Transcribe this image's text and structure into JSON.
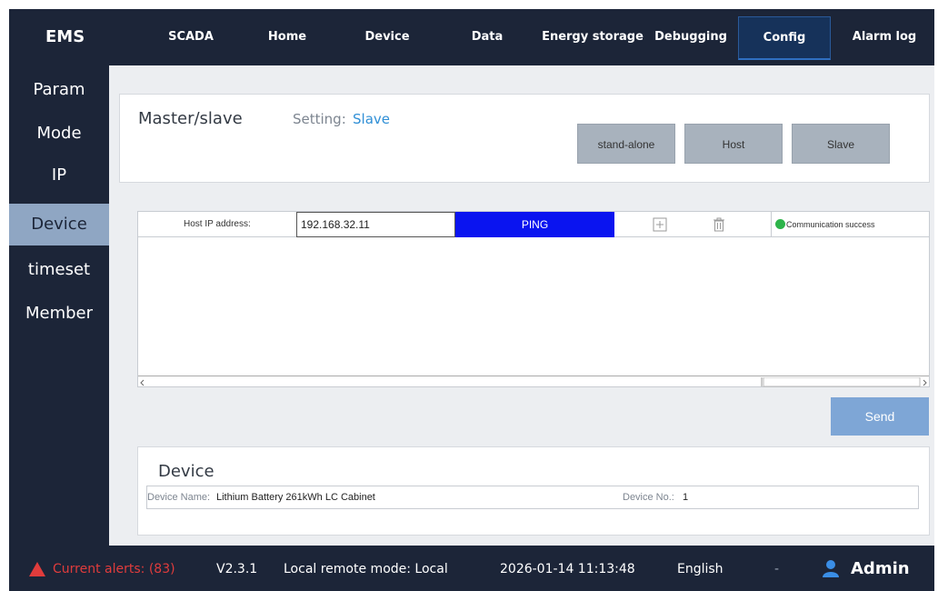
{
  "app": {
    "logo": "EMS",
    "nav": [
      "SCADA",
      "Home",
      "Device",
      "Data",
      "Energy storage",
      "Debugging",
      "Config",
      "Alarm log"
    ],
    "active_nav": "Config"
  },
  "sidebar": {
    "items": [
      "Param",
      "Mode",
      "IP",
      "Device",
      "timeset",
      "Member"
    ],
    "active": "Device"
  },
  "master_slave": {
    "title": "Master/slave",
    "setting_label": "Setting:",
    "setting_value": "Slave",
    "buttons": [
      "stand-alone",
      "Host",
      "Slave"
    ]
  },
  "host_table": {
    "host_ip_label": "Host IP address:",
    "host_ip_value": "192.168.32.11",
    "ping_label": "PING",
    "status_text": "Communication success",
    "add_icon": "plus-icon",
    "delete_icon": "trash-icon"
  },
  "send_label": "Send",
  "device": {
    "title": "Device",
    "name_label": "Device Name:",
    "name_value": "Lithium Battery 261kWh LC Cabinet",
    "no_label": "Device No.:",
    "no_value": "1"
  },
  "footer": {
    "alerts": "Current alerts: (83)",
    "version": "V2.3.1",
    "mode": "Local remote mode: Local",
    "datetime": "2026-01-14 11:13:48",
    "language": "English",
    "dropdown_caret": "-",
    "user": "Admin"
  },
  "colors": {
    "background": "#1c2538",
    "accent_blue": "#0a14f0",
    "send_button": "#7ea6d6",
    "alert_red": "#e03c3c",
    "success_green": "#2db44a"
  }
}
